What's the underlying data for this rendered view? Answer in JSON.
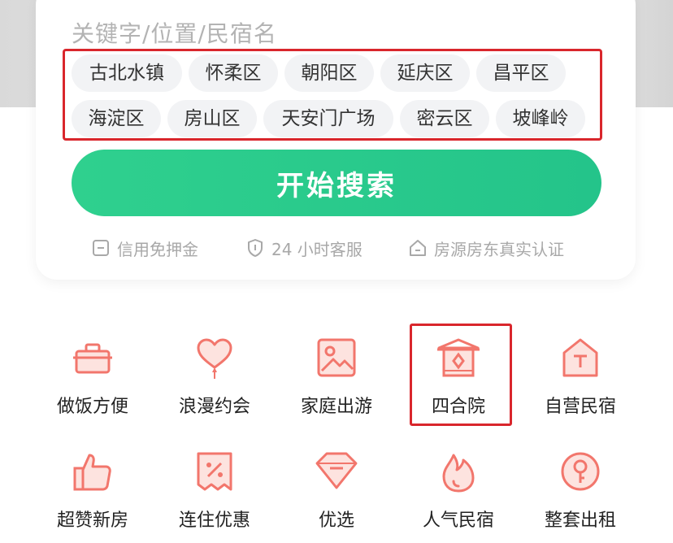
{
  "search": {
    "placeholder_text": "关键字/位置/民宿名"
  },
  "tags": [
    "古北水镇",
    "怀柔区",
    "朝阳区",
    "延庆区",
    "昌平区",
    "海淀区",
    "房山区",
    "天安门广场",
    "密云区",
    "坡峰岭"
  ],
  "search_button": {
    "label": "开始搜索"
  },
  "features": [
    {
      "icon": "deposit-card-icon",
      "label": "信用免押金"
    },
    {
      "icon": "shield-icon",
      "label": "24 小时客服"
    },
    {
      "icon": "house-icon",
      "label": "房源房东真实认证"
    }
  ],
  "categories": [
    {
      "icon": "pot-icon",
      "label": "做饭方便"
    },
    {
      "icon": "heart-balloon-icon",
      "label": "浪漫约会"
    },
    {
      "icon": "picture-icon",
      "label": "家庭出游"
    },
    {
      "icon": "courtyard-gate-icon",
      "label": "四合院"
    },
    {
      "icon": "house-t-icon",
      "label": "自营民宿"
    },
    {
      "icon": "thumbs-up-icon",
      "label": "超赞新房"
    },
    {
      "icon": "discount-coupon-icon",
      "label": "连住优惠"
    },
    {
      "icon": "diamond-icon",
      "label": "优选"
    },
    {
      "icon": "flame-icon",
      "label": "人气民宿"
    },
    {
      "icon": "key-icon",
      "label": "整套出租"
    }
  ],
  "colors": {
    "accent_green": "#2fd08e",
    "icon_coral": "#f2766c",
    "highlight_red": "#d9262c"
  }
}
